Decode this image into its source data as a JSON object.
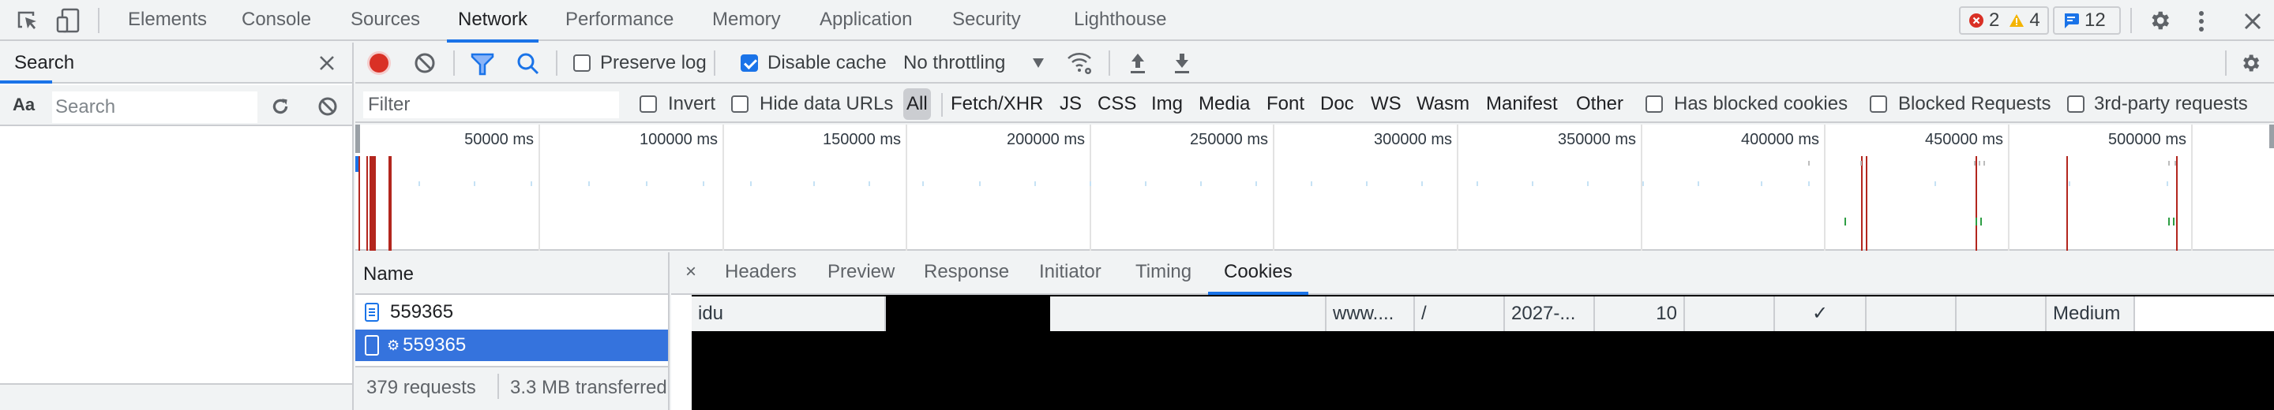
{
  "topbar": {
    "tabs": [
      {
        "label": "Elements",
        "active": false
      },
      {
        "label": "Console",
        "active": false
      },
      {
        "label": "Sources",
        "active": false
      },
      {
        "label": "Network",
        "active": true
      },
      {
        "label": "Performance",
        "active": false
      },
      {
        "label": "Memory",
        "active": false
      },
      {
        "label": "Application",
        "active": false
      },
      {
        "label": "Security",
        "active": false
      },
      {
        "label": "Lighthouse",
        "active": false
      }
    ],
    "errors_count": "2",
    "warnings_count": "4",
    "messages_count": "12",
    "icons": {
      "inspect": "inspect-element-icon",
      "device": "device-toolbar-icon",
      "settings": "gear-icon",
      "more": "kebab-menu-icon",
      "close": "close-icon"
    }
  },
  "search_panel": {
    "title": "Search",
    "match_case_label": "Aa",
    "regex_label": ".*",
    "search_placeholder": "Search",
    "search_value": ""
  },
  "network_toolbar": {
    "preserve_log_label": "Preserve log",
    "preserve_log_checked": false,
    "disable_cache_label": "Disable cache",
    "disable_cache_checked": true,
    "throttling": "No throttling",
    "record_color": "#d93025"
  },
  "filter_bar": {
    "filter_placeholder": "Filter",
    "invert_label": "Invert",
    "invert_checked": false,
    "hide_data_urls_label": "Hide data URLs",
    "hide_data_urls_checked": false,
    "types": [
      {
        "label": "All",
        "active": true
      },
      {
        "label": "Fetch/XHR",
        "active": false
      },
      {
        "label": "JS",
        "active": false
      },
      {
        "label": "CSS",
        "active": false
      },
      {
        "label": "Img",
        "active": false
      },
      {
        "label": "Media",
        "active": false
      },
      {
        "label": "Font",
        "active": false
      },
      {
        "label": "Doc",
        "active": false
      },
      {
        "label": "WS",
        "active": false
      },
      {
        "label": "Wasm",
        "active": false
      },
      {
        "label": "Manifest",
        "active": false
      },
      {
        "label": "Other",
        "active": false
      }
    ],
    "has_blocked_cookies_label": "Has blocked cookies",
    "blocked_requests_label": "Blocked Requests",
    "third_party_label": "3rd-party requests"
  },
  "overview": {
    "tick_labels": [
      "50000 ms",
      "100000 ms",
      "150000 ms",
      "200000 ms",
      "250000 ms",
      "300000 ms",
      "350000 ms",
      "400000 ms",
      "450000 ms",
      "500000 ms"
    ],
    "load_marker_color": "#b3261e"
  },
  "request_list": {
    "column_header": "Name",
    "rows": [
      {
        "name": "559365",
        "icon": "document-icon",
        "selected": false
      },
      {
        "name": "559365",
        "icon": "service-worker-icon",
        "prefix": "⚙",
        "selected": true
      }
    ],
    "requests_count": "379 requests",
    "transferred": "3.3 MB transferred"
  },
  "details": {
    "close_label": "×",
    "tabs": [
      {
        "label": "Headers",
        "active": false
      },
      {
        "label": "Preview",
        "active": false
      },
      {
        "label": "Response",
        "active": false
      },
      {
        "label": "Initiator",
        "active": false
      },
      {
        "label": "Timing",
        "active": false
      },
      {
        "label": "Cookies",
        "active": true
      }
    ],
    "cookie_row": {
      "name": "idu",
      "value": "",
      "domain": "www....",
      "path": "/",
      "expires": "2027-...",
      "size": "10",
      "httponly": "",
      "secure": "✓",
      "samesite": "",
      "partition_key": "",
      "priority": "Medium"
    }
  }
}
